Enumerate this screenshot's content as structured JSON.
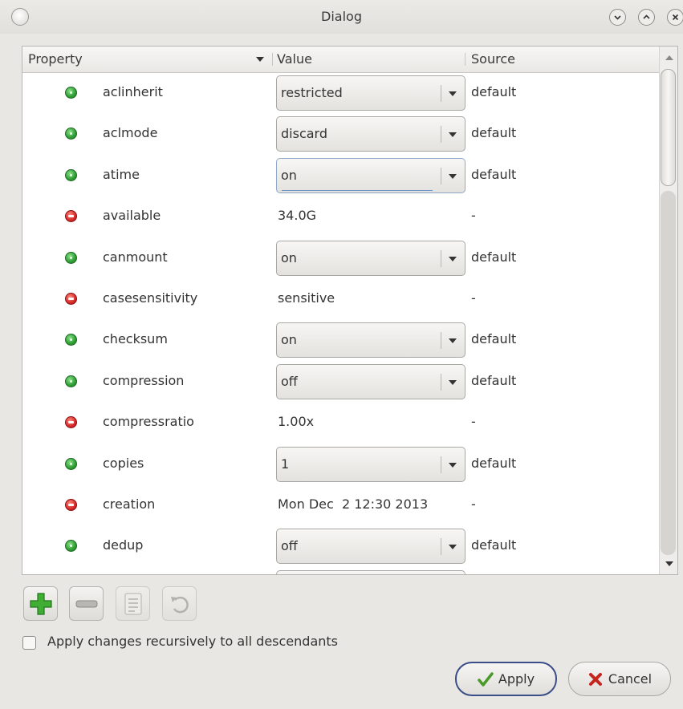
{
  "window": {
    "title": "Dialog"
  },
  "table": {
    "headers": {
      "property": "Property",
      "value": "Value",
      "source": "Source"
    },
    "rows": [
      {
        "status": "green",
        "name": "aclinherit",
        "value": "restricted",
        "editable": true,
        "source": "default"
      },
      {
        "status": "green",
        "name": "aclmode",
        "value": "discard",
        "editable": true,
        "source": "default"
      },
      {
        "status": "green",
        "name": "atime",
        "value": "on",
        "editable": true,
        "source": "default",
        "focused": true
      },
      {
        "status": "red",
        "name": "available",
        "value": "34.0G",
        "editable": false,
        "source": "-"
      },
      {
        "status": "green",
        "name": "canmount",
        "value": "on",
        "editable": true,
        "source": "default"
      },
      {
        "status": "red",
        "name": "casesensitivity",
        "value": "sensitive",
        "editable": false,
        "source": "-"
      },
      {
        "status": "green",
        "name": "checksum",
        "value": "on",
        "editable": true,
        "source": "default"
      },
      {
        "status": "green",
        "name": "compression",
        "value": "off",
        "editable": true,
        "source": "default"
      },
      {
        "status": "red",
        "name": "compressratio",
        "value": "1.00x",
        "editable": false,
        "source": "-"
      },
      {
        "status": "green",
        "name": "copies",
        "value": "1",
        "editable": true,
        "source": "default"
      },
      {
        "status": "red",
        "name": "creation",
        "value": "Mon Dec  2 12:30 2013",
        "editable": false,
        "source": "-"
      },
      {
        "status": "green",
        "name": "dedup",
        "value": "off",
        "editable": true,
        "source": "default"
      },
      {
        "status": "green",
        "name": "",
        "value": "",
        "editable": true,
        "source": ""
      }
    ]
  },
  "toolbar": {
    "buttons": [
      {
        "icon": "plus-icon",
        "enabled": true
      },
      {
        "icon": "minus-icon",
        "enabled": true
      },
      {
        "icon": "list-icon",
        "enabled": false
      },
      {
        "icon": "undo-icon",
        "enabled": false
      }
    ]
  },
  "options": {
    "recursive_label": "Apply changes recursively to all descendants",
    "recursive_checked": false
  },
  "buttons": {
    "apply": "Apply",
    "cancel": "Cancel"
  },
  "colors": {
    "status_green": "#2f9d34",
    "status_red": "#d62a2a",
    "apply_border": "#3a4d87"
  }
}
